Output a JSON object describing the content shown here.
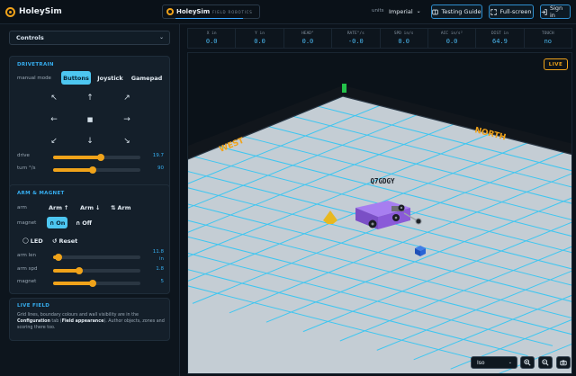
{
  "app": {
    "brand_name": "HoleySim",
    "center_name": "HoleySim",
    "center_subtitle": "FIELD ROBOTICS"
  },
  "topbar": {
    "units_label": "units",
    "units_value": "Imperial",
    "testing_guide": "Testing Guide",
    "fullscreen": "Full-screen",
    "sign_in": "Sign in"
  },
  "sidebar": {
    "panel_select": "Controls",
    "drivetrain": {
      "title": "DRIVETRAIN",
      "mode_label": "manual mode",
      "modes": [
        "Buttons",
        "Joystick",
        "Gamepad"
      ],
      "active_mode": "Buttons",
      "sliders": [
        {
          "label": "drive",
          "value": "19.7",
          "fraction": 0.55
        },
        {
          "label": "turn °/s",
          "value": "90",
          "fraction": 0.45
        }
      ]
    },
    "arm": {
      "title": "ARM & MAGNET",
      "arm_label": "arm",
      "arm_up": "Arm",
      "arm_down": "Arm",
      "arm_toggle": "Arm",
      "magnet_label": "magnet",
      "magnet_on": "On",
      "magnet_off": "Off",
      "led": "LED",
      "reset": "Reset",
      "sliders": [
        {
          "label": "arm len",
          "value": "11.8",
          "unit": "in",
          "fraction": 0.06
        },
        {
          "label": "arm spd",
          "value": "1.8",
          "unit": "",
          "fraction": 0.3
        },
        {
          "label": "magnet",
          "value": "5",
          "unit": "",
          "fraction": 0.45
        }
      ]
    },
    "live_field": {
      "title": "LIVE FIELD",
      "text_1": "Grid lines, boundary colours and wall visibility are in the ",
      "text_bold_1": "Configuration",
      "text_2": " tab (",
      "text_bold_2": "Field appearance",
      "text_3": "). Author objects, zones and scoring there too."
    }
  },
  "hud": [
    {
      "label": "X in",
      "value": "0.0"
    },
    {
      "label": "Y in",
      "value": "0.0"
    },
    {
      "label": "HEAD°",
      "value": "0.0"
    },
    {
      "label": "RATE°/s",
      "value": "-0.0"
    },
    {
      "label": "SPD in/s",
      "value": "0.0"
    },
    {
      "label": "ACC in/s²",
      "value": "0.0"
    },
    {
      "label": "DIST in",
      "value": "64.9"
    },
    {
      "label": "TOUCH",
      "value": "no"
    }
  ],
  "field": {
    "live_badge": "LIVE",
    "west_label": "WEST",
    "north_label": "NORTH",
    "robot_label": "Q7GDGY",
    "view_select": "Iso",
    "colors": {
      "grid": "#3fc6f0",
      "floor": "#c4cdd4",
      "wall_accent": "#f0a31a",
      "robot": "#8a5ad8",
      "cone": "#e8b820",
      "cube": "#2a64d6",
      "marker": "#24c24a"
    }
  }
}
